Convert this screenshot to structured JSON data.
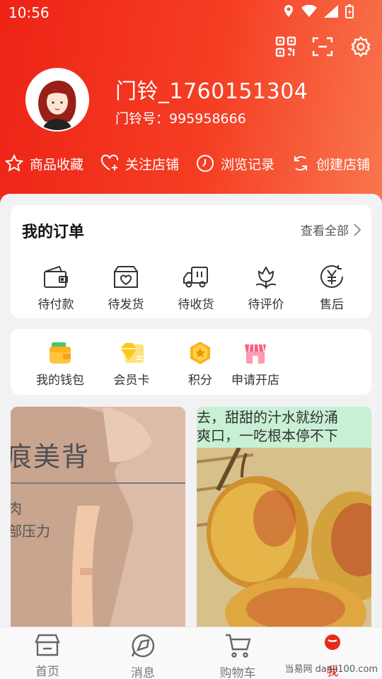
{
  "status_bar": {
    "time": "10:56"
  },
  "header": {
    "username": "门铃_1760151304",
    "member_id": "门铃号：995958666",
    "quick_links": [
      {
        "label": "商品收藏",
        "icon": "star-icon"
      },
      {
        "label": "关注店铺",
        "icon": "heart-plus-icon"
      },
      {
        "label": "浏览记录",
        "icon": "clock-icon"
      },
      {
        "label": "创建店铺",
        "icon": "refresh-icon"
      }
    ]
  },
  "orders": {
    "title": "我的订单",
    "view_all": "查看全部",
    "items": [
      {
        "label": "待付款",
        "icon": "wallet-icon"
      },
      {
        "label": "待发货",
        "icon": "box-icon"
      },
      {
        "label": "待收货",
        "icon": "truck-icon"
      },
      {
        "label": "待评价",
        "icon": "flower-icon"
      },
      {
        "label": "售后",
        "icon": "yen-refund-icon"
      }
    ]
  },
  "services": {
    "items": [
      {
        "label": "我的钱包",
        "icon": "wallet-color-icon"
      },
      {
        "label": "会员卡",
        "icon": "vip-card-icon"
      },
      {
        "label": "积分",
        "icon": "points-icon"
      },
      {
        "label": "申请开店",
        "icon": "shop-icon"
      }
    ]
  },
  "products": [
    {
      "banner_text": "痕美背",
      "subtext": "肉\n部压力"
    },
    {
      "banner_text": "去，甜甜的汁水就纷涌\n爽口，一吃根本停不下"
    }
  ],
  "tabbar": {
    "items": [
      {
        "label": "首页",
        "icon": "home-icon"
      },
      {
        "label": "消息",
        "icon": "message-icon"
      },
      {
        "label": "购物车",
        "icon": "cart-icon"
      },
      {
        "label": "我",
        "icon": "profile-icon"
      }
    ],
    "active_index": 3
  },
  "watermark": "当易网 danji100.com",
  "colors": {
    "brand": "#ee2316",
    "brand_light": "#f8774f",
    "accent_text": "#e52b19"
  }
}
